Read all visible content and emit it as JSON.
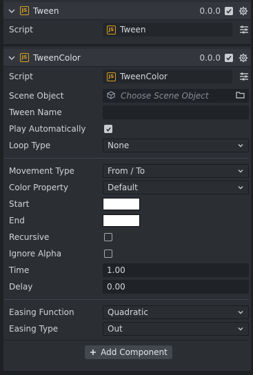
{
  "components": [
    {
      "title": "Tween",
      "version": "0.0.0",
      "enabled": true,
      "rows": {
        "script_label": "Script",
        "script_value": "Tween"
      }
    },
    {
      "title": "TweenColor",
      "version": "0.0.0",
      "enabled": true,
      "rows": {
        "script_label": "Script",
        "script_value": "TweenColor",
        "scene_object_label": "Scene Object",
        "scene_object_placeholder": "Choose Scene Object",
        "tween_name_label": "Tween Name",
        "tween_name_value": "",
        "play_auto_label": "Play Automatically",
        "play_auto_checked": true,
        "loop_type_label": "Loop Type",
        "loop_type_value": "None",
        "movement_type_label": "Movement Type",
        "movement_type_value": "From / To",
        "color_property_label": "Color Property",
        "color_property_value": "Default",
        "start_label": "Start",
        "start_color": "#ffffff",
        "end_label": "End",
        "end_color": "#ffffff",
        "recursive_label": "Recursive",
        "recursive_checked": false,
        "ignore_alpha_label": "Ignore Alpha",
        "ignore_alpha_checked": false,
        "time_label": "Time",
        "time_value": "1.00",
        "delay_label": "Delay",
        "delay_value": "0.00",
        "easing_function_label": "Easing Function",
        "easing_function_value": "Quadratic",
        "easing_type_label": "Easing Type",
        "easing_type_value": "Out"
      }
    }
  ],
  "add_component_label": "Add Component",
  "icons": {
    "collapse": "chevron-down-icon",
    "script": "js-file-icon",
    "settings": "gear-icon",
    "list": "list-settings-icon",
    "scene_object": "scene-object-icon",
    "folder": "folder-icon",
    "add": "plus-icon"
  },
  "colors": {
    "js_badge": "#d9a224",
    "panel_bg": "#2b2e33",
    "field_bg": "#1f2226"
  }
}
